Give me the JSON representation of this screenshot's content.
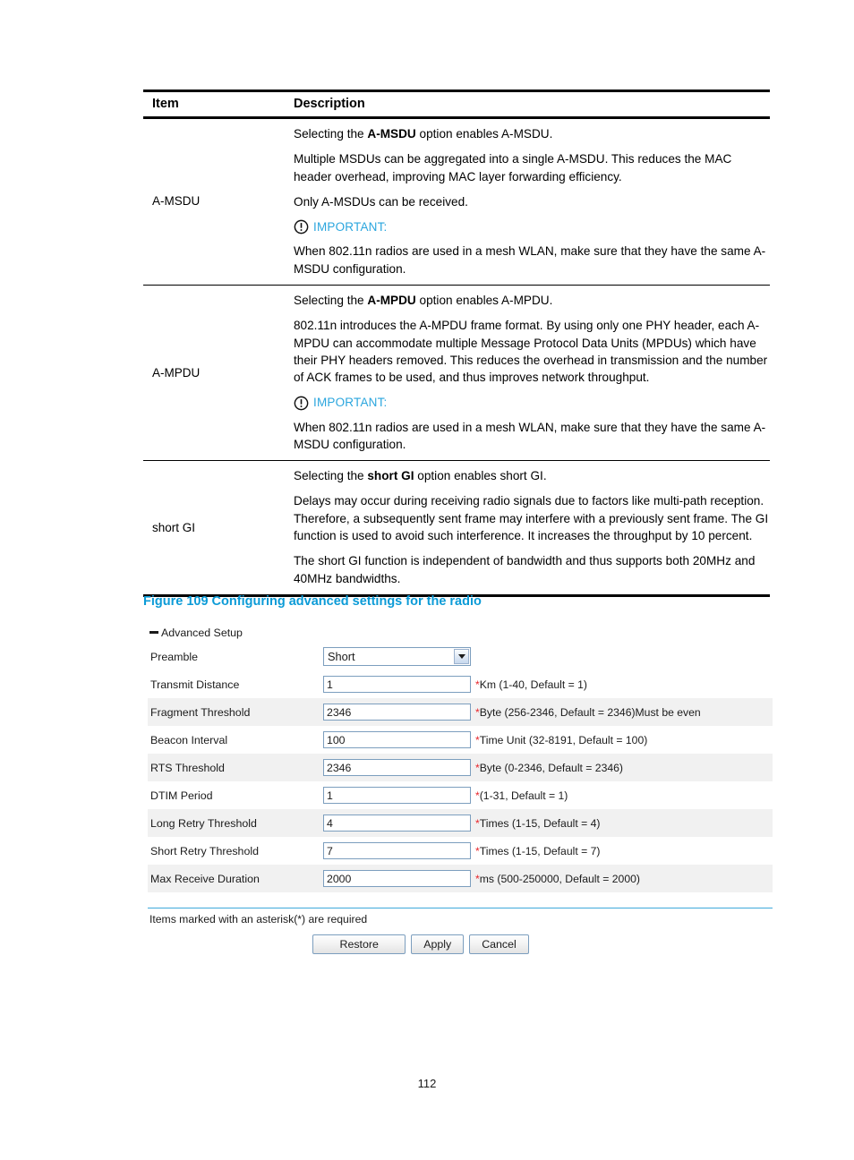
{
  "table": {
    "headers": {
      "item": "Item",
      "description": "Description"
    },
    "rows": [
      {
        "item": "A-MSDU",
        "paragraphs": [
          "Selecting the <b>A-MSDU</b> option enables A-MSDU.",
          "Multiple MSDUs can be aggregated into a single A-MSDU. This reduces the MAC header overhead, improving MAC layer forwarding efficiency.",
          "Only A-MSDUs can be received."
        ],
        "important_label": "IMPORTANT:",
        "important_icon": "exclamation-circle-icon",
        "after_important": [
          "When 802.11n radios are used in a mesh WLAN, make sure that they have the same A-MSDU configuration."
        ]
      },
      {
        "item": "A-MPDU",
        "paragraphs": [
          "Selecting the <b>A-MPDU</b> option enables A-MPDU.",
          "802.11n introduces the A-MPDU frame format. By using only one PHY header, each A-MPDU can accommodate multiple Message Protocol Data Units (MPDUs) which have their PHY headers removed. This reduces the overhead in transmission and the number of ACK frames to be used, and thus improves network throughput."
        ],
        "important_label": "IMPORTANT:",
        "important_icon": "exclamation-circle-icon",
        "after_important": [
          "When 802.11n radios are used in a mesh WLAN, make sure that they have the same A-MSDU configuration."
        ]
      },
      {
        "item": "short GI",
        "paragraphs": [
          "Selecting the <b>short GI</b> option enables short GI.",
          "Delays may occur during receiving radio signals due to factors like multi-path reception. Therefore, a subsequently sent frame may interfere with a previously sent frame. The GI function is used to avoid such interference. It increases the throughput by 10 percent.",
          "The short GI function is independent of bandwidth and thus supports both 20MHz and 40MHz bandwidths."
        ],
        "important_label": "",
        "important_icon": "",
        "after_important": []
      }
    ]
  },
  "figure": {
    "caption": "Figure 109 Configuring advanced settings for the radio",
    "caption_color": "#0C9BD7"
  },
  "panel": {
    "section_title": "Advanced Setup",
    "collapse_icon": "minus-icon",
    "rows": [
      {
        "label": "Preamble",
        "control": "select",
        "value": "Short",
        "hint": "",
        "hint_star": "",
        "striped": false
      },
      {
        "label": "Transmit Distance",
        "control": "input",
        "value": "1",
        "hint_star": "*",
        "hint": "Km (1-40, Default = 1)",
        "striped": false
      },
      {
        "label": "Fragment Threshold",
        "control": "input",
        "value": "2346",
        "hint_star": "*",
        "hint": "Byte (256-2346, Default = 2346)Must be even",
        "striped": true
      },
      {
        "label": "Beacon Interval",
        "control": "input",
        "value": "100",
        "hint_star": "*",
        "hint": "Time Unit (32-8191, Default = 100)",
        "striped": false
      },
      {
        "label": "RTS Threshold",
        "control": "input",
        "value": "2346",
        "hint_star": "*",
        "hint": "Byte (0-2346, Default = 2346)",
        "striped": true
      },
      {
        "label": "DTIM Period",
        "control": "input",
        "value": "1",
        "hint_star": "*",
        "hint": "(1-31, Default = 1)",
        "striped": false
      },
      {
        "label": "Long Retry Threshold",
        "control": "input",
        "value": "4",
        "hint_star": "*",
        "hint": "Times (1-15, Default = 4)",
        "striped": true
      },
      {
        "label": "Short Retry Threshold",
        "control": "input",
        "value": "7",
        "hint_star": "*",
        "hint": "Times (1-15, Default = 7)",
        "striped": false
      },
      {
        "label": "Max Receive Duration",
        "control": "input",
        "value": "2000",
        "hint_star": "*",
        "hint": "ms (500-250000, Default = 2000)",
        "striped": true
      }
    ],
    "required_note": "Items marked with an asterisk(*) are required",
    "buttons": [
      {
        "label": "Restore",
        "wide": true
      },
      {
        "label": "Apply",
        "wide": false
      },
      {
        "label": "Cancel",
        "wide": false
      }
    ],
    "divider_color": "#3FA9DB"
  },
  "page": {
    "number": "112"
  }
}
